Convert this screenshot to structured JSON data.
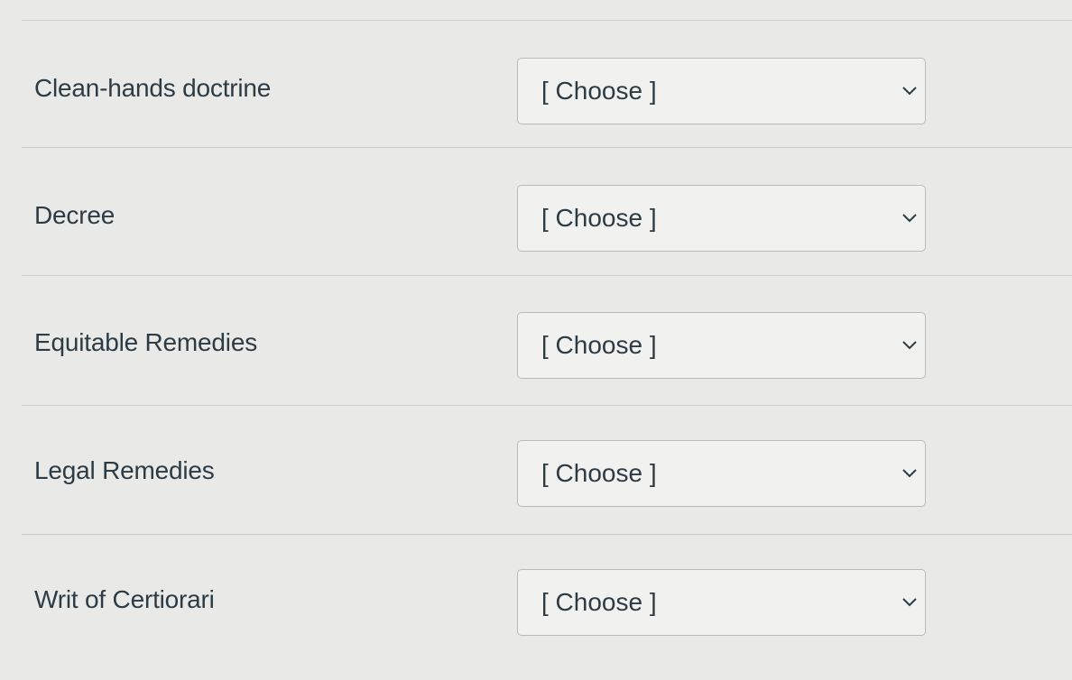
{
  "rows": [
    {
      "term": "Clean-hands doctrine",
      "selected": "[ Choose ]"
    },
    {
      "term": "Decree",
      "selected": "[ Choose ]"
    },
    {
      "term": "Equitable Remedies",
      "selected": "[ Choose ]"
    },
    {
      "term": "Legal Remedies",
      "selected": "[ Choose ]"
    },
    {
      "term": "Writ of Certiorari",
      "selected": "[ Choose ]"
    }
  ],
  "icons": {
    "dropdown": "chevron-down-icon"
  },
  "colors": {
    "background": "#e9eae8",
    "text": "#2d3b45",
    "select_border": "#b9bbba",
    "divider": "#c9cbc9"
  }
}
